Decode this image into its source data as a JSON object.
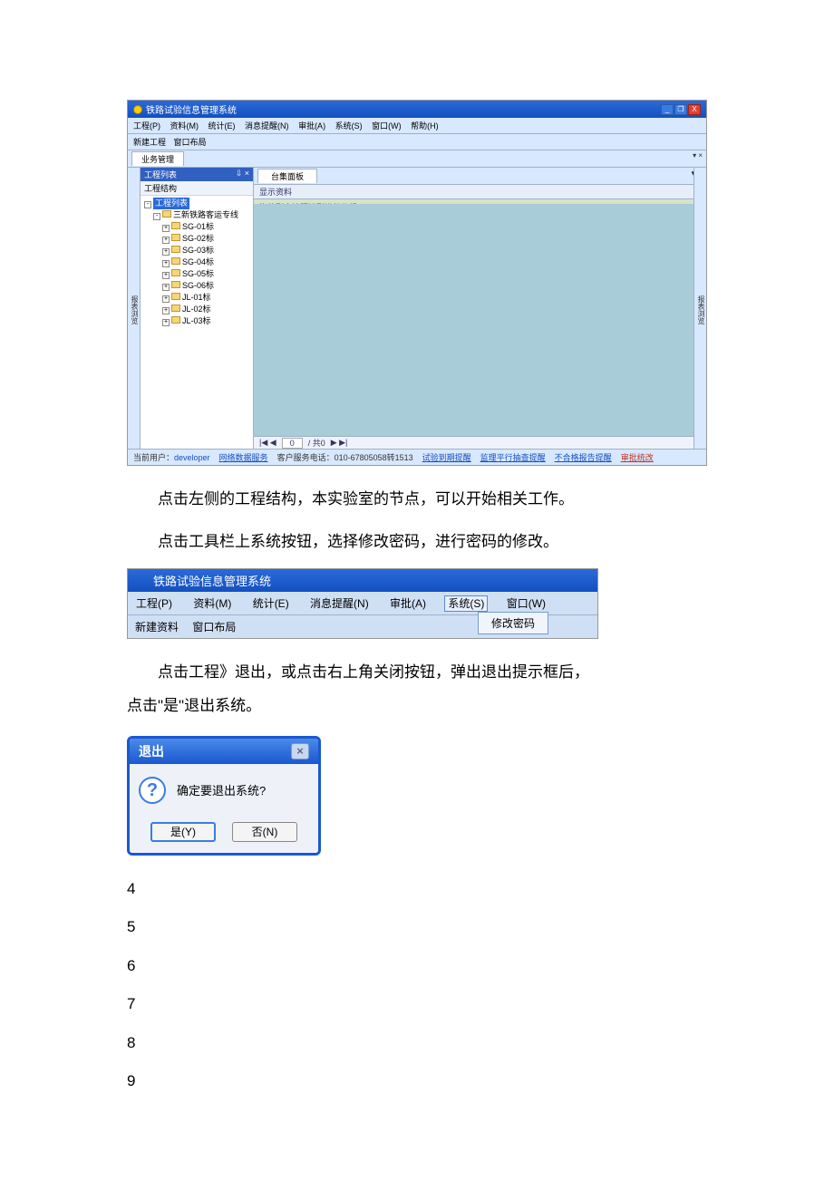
{
  "app": {
    "title": "铁路试验信息管理系统",
    "win_btns": {
      "min": "_",
      "max": "❐",
      "close": "X"
    },
    "menu": [
      "工程(P)",
      "资料(M)",
      "统计(E)",
      "消息提醒(N)",
      "审批(A)",
      "系统(S)",
      "窗口(W)",
      "帮助(H)"
    ],
    "toolbar": [
      "新建工程",
      "窗口布局"
    ],
    "tab_main": "业务管理",
    "tab_pin": "▾ ×",
    "left_rail": "报表浏览",
    "side": {
      "header": "工程列表",
      "header_ctrl": "⇩ ×",
      "sub": "工程结构",
      "tree_root": "工程列表",
      "tree_proj": "三新铁路客运专线",
      "tree_items": [
        "SG-01标",
        "SG-02标",
        "SG-03标",
        "SG-04标",
        "SG-05标",
        "SG-06标",
        "JL-01标",
        "JL-02标",
        "JL-03标"
      ]
    },
    "main": {
      "tab": "台集面板",
      "tab_right": "▾ ×",
      "subbar": "显示资料",
      "group": "拖放列会按照该列进行分组",
      "right_rail": "报表浏览",
      "pager": {
        "nav1": "|◀ ◀",
        "page": "0",
        "of_label": "/ 共0",
        "nav2": "▶ ▶|"
      }
    },
    "status": {
      "user_label": "当前用户：",
      "user": "developer",
      "netlabel": "网络数据服务",
      "support": "客户服务电话：010-67805058转1513",
      "links": [
        "试验到期提醒",
        "监理平行抽查提醒",
        "不合格报告提醒"
      ],
      "link_red": "审批统改"
    }
  },
  "text": {
    "p1": "点击左侧的工程结构，本实验室的节点，可以开始相关工作。",
    "p2": "点击工具栏上系统按钮，选择修改密码，进行密码的修改。",
    "p3a": "点击工程》退出，或点击右上角关闭按钮，弹出退出提示框后，",
    "p3b": "点击\"是\"退出系统。"
  },
  "s2": {
    "title": "铁路试验信息管理系统",
    "menu": [
      "工程(P)",
      "资料(M)",
      "统计(E)",
      "消息提醒(N)",
      "审批(A)",
      "系统(S)",
      "窗口(W)"
    ],
    "dropdown": "修改密码",
    "toolbar": [
      "新建资料",
      "窗口布局"
    ]
  },
  "dialog": {
    "title": "退出",
    "msg": "确定要退出系统?",
    "yes": "是(Y)",
    "no": "否(N)"
  },
  "nums": [
    "4",
    "5",
    "6",
    "7",
    "8",
    "9"
  ]
}
